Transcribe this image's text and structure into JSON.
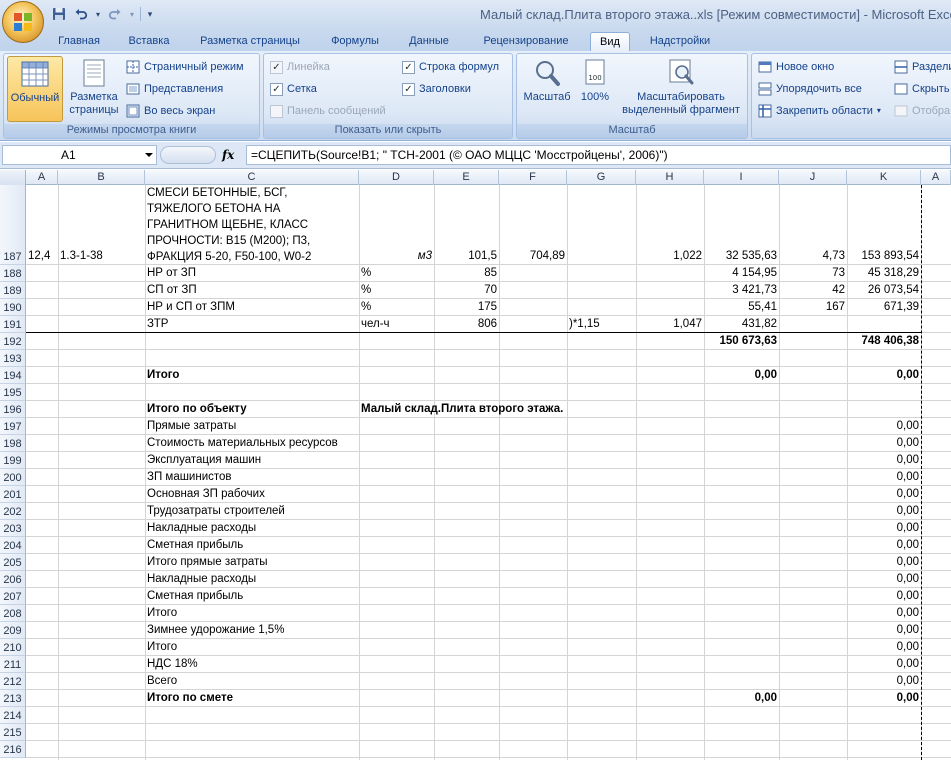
{
  "window": {
    "title": "Малый склад.Плита второго этажа..xls  [Режим совместимости] - Microsoft Excel"
  },
  "qat": {
    "icons": [
      "save-icon",
      "undo-icon",
      "redo-icon",
      "customize-icon"
    ]
  },
  "tabs": [
    {
      "label": "Главная",
      "active": false
    },
    {
      "label": "Вставка",
      "active": false
    },
    {
      "label": "Разметка страницы",
      "active": false
    },
    {
      "label": "Формулы",
      "active": false
    },
    {
      "label": "Данные",
      "active": false
    },
    {
      "label": "Рецензирование",
      "active": false
    },
    {
      "label": "Вид",
      "active": true
    },
    {
      "label": "Надстройки",
      "active": false
    }
  ],
  "ribbon": {
    "group_views": {
      "label": "Режимы просмотра книги",
      "normal": "Обычный",
      "page_layout_1": "Разметка",
      "page_layout_2": "страницы",
      "page_break": "Страничный режим",
      "custom_views": "Представления",
      "full_screen": "Во весь экран"
    },
    "group_show": {
      "label": "Показать или скрыть",
      "ruler": "Линейка",
      "gridlines": "Сетка",
      "message_bar": "Панель сообщений",
      "formula_bar": "Строка формул",
      "headings": "Заголовки"
    },
    "group_zoom": {
      "label": "Масштаб",
      "zoom": "Масштаб",
      "zoom100": "100%",
      "zoom_sel_1": "Масштабировать",
      "zoom_sel_2": "выделенный фрагмент"
    },
    "group_window": {
      "new_window": "Новое окно",
      "arrange_all": "Упорядочить все",
      "freeze": "Закрепить области",
      "split": "Раздели",
      "hide": "Скрыть",
      "unhide": "Отобра"
    }
  },
  "formula_bar": {
    "name_box": "A1",
    "fx": "fx",
    "formula": "=СЦЕПИТЬ(Source!B1; \"    ТСН-2001 (© ОАО МЦЦС 'Мосстройцены', 2006)\")"
  },
  "grid": {
    "columns": [
      "A",
      "B",
      "C",
      "D",
      "E",
      "F",
      "G",
      "H",
      "I",
      "J",
      "K",
      "A"
    ],
    "rows": [
      {
        "num": "187",
        "A": "12,4",
        "B": "1.3-1-38",
        "C": [
          "СМЕСИ БЕТОННЫЕ, БСГ,",
          "ТЯЖЕЛОГО БЕТОНА НА",
          "ГРАНИТНОМ ЩЕБНЕ, КЛАСС",
          "ПРОЧНОСТИ: В15 (М200); П3,",
          "ФРАКЦИЯ 5-20, F50-100, W0-2"
        ],
        "D": "м3",
        "E": "101,5",
        "F": "704,89",
        "H": "1,022",
        "I": "32 535,63",
        "J": "4,73",
        "K": "153 893,54"
      },
      {
        "num": "188",
        "C": "НР от ЗП",
        "D": "%",
        "E": "85",
        "I": "4 154,95",
        "J": "73",
        "K": "45 318,29"
      },
      {
        "num": "189",
        "C": "СП от ЗП",
        "D": "%",
        "E": "70",
        "I": "3 421,73",
        "J": "42",
        "K": "26 073,54"
      },
      {
        "num": "190",
        "C": "НР и СП от ЗПМ",
        "D": "%",
        "E": "175",
        "I": "55,41",
        "J": "167",
        "K": "671,39"
      },
      {
        "num": "191",
        "C": "ЗТР",
        "D": "чел-ч",
        "E": "806",
        "G": ")*1,15",
        "H": "1,047",
        "I": "431,82"
      },
      {
        "num": "192",
        "I": "150 673,63",
        "K": "748 406,38"
      },
      {
        "num": "193"
      },
      {
        "num": "194",
        "C": "Итого",
        "I": "0,00",
        "K": "0,00"
      },
      {
        "num": "195"
      },
      {
        "num": "196",
        "C": "Итого по объекту",
        "D": "Малый склад.Плита второго этажа."
      },
      {
        "num": "197",
        "C": "Прямые затраты",
        "K": "0,00"
      },
      {
        "num": "198",
        "C": "Стоимость материальных ресурсов",
        "K": "0,00"
      },
      {
        "num": "199",
        "C": "Эксплуатация машин",
        "K": "0,00"
      },
      {
        "num": "200",
        "C": "ЗП машинистов",
        "K": "0,00"
      },
      {
        "num": "201",
        "C": "Основная ЗП рабочих",
        "K": "0,00"
      },
      {
        "num": "202",
        "C": "Трудозатраты строителей",
        "K": "0,00"
      },
      {
        "num": "203",
        "C": "Накладные расходы",
        "K": "0,00"
      },
      {
        "num": "204",
        "C": "Сметная прибыль",
        "K": "0,00"
      },
      {
        "num": "205",
        "C": "Итого прямые затраты",
        "K": "0,00"
      },
      {
        "num": "206",
        "C": "Накладные расходы",
        "K": "0,00"
      },
      {
        "num": "207",
        "C": "Сметная прибыль",
        "K": "0,00"
      },
      {
        "num": "208",
        "C": "Итого",
        "K": "0,00"
      },
      {
        "num": "209",
        "C": "Зимнее удорожание 1,5%",
        "K": "0,00"
      },
      {
        "num": "210",
        "C": "Итого",
        "K": "0,00"
      },
      {
        "num": "211",
        "C": "НДС 18%",
        "K": "0,00"
      },
      {
        "num": "212",
        "C": "Всего",
        "K": "0,00"
      },
      {
        "num": "213",
        "C": "Итого по смете",
        "I": "0,00",
        "K": "0,00"
      },
      {
        "num": "214"
      },
      {
        "num": "215"
      },
      {
        "num": "216"
      }
    ]
  }
}
